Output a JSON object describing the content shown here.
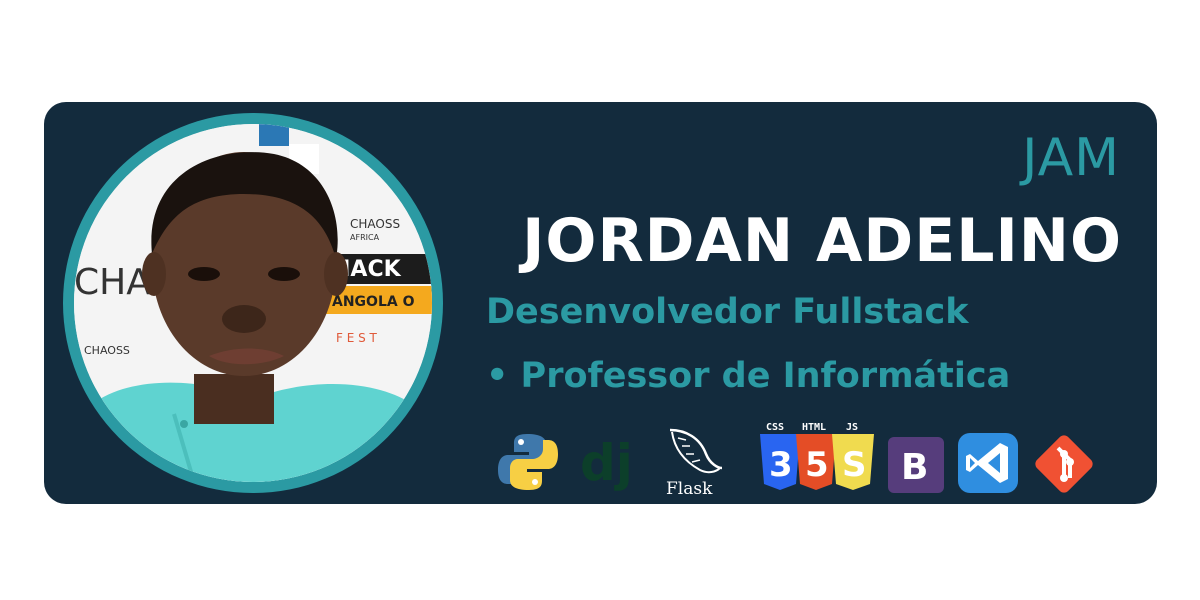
{
  "profile": {
    "nickname": "JAM",
    "name": "JORDAN ADELINO",
    "role_primary": "Desenvolvedor Fullstack",
    "role_secondary": "• Professor de Informática"
  },
  "photo_banner": {
    "brand_line1": "CHAOSS",
    "brand_line2": "AFRICA",
    "hack": "HACK",
    "event": "ANGOLA O",
    "fest": "F E S T",
    "side": "CHA"
  },
  "tech_icons": [
    {
      "icon": "python-icon"
    },
    {
      "icon": "django-icon",
      "label": "dj"
    },
    {
      "icon": "flask-icon",
      "label": "Flask"
    },
    {
      "icon": "css-html-js-icon",
      "labels": [
        "CSS",
        "HTML",
        "JS"
      ]
    },
    {
      "icon": "bootstrap-icon",
      "label": "B"
    },
    {
      "icon": "vscode-icon"
    },
    {
      "icon": "git-icon"
    }
  ],
  "colors": {
    "card": "#132b3d",
    "accent": "#2b9aa3",
    "name": "#ffffff",
    "shirt": "#5fd3d0",
    "skin": "#5a3a2a"
  }
}
